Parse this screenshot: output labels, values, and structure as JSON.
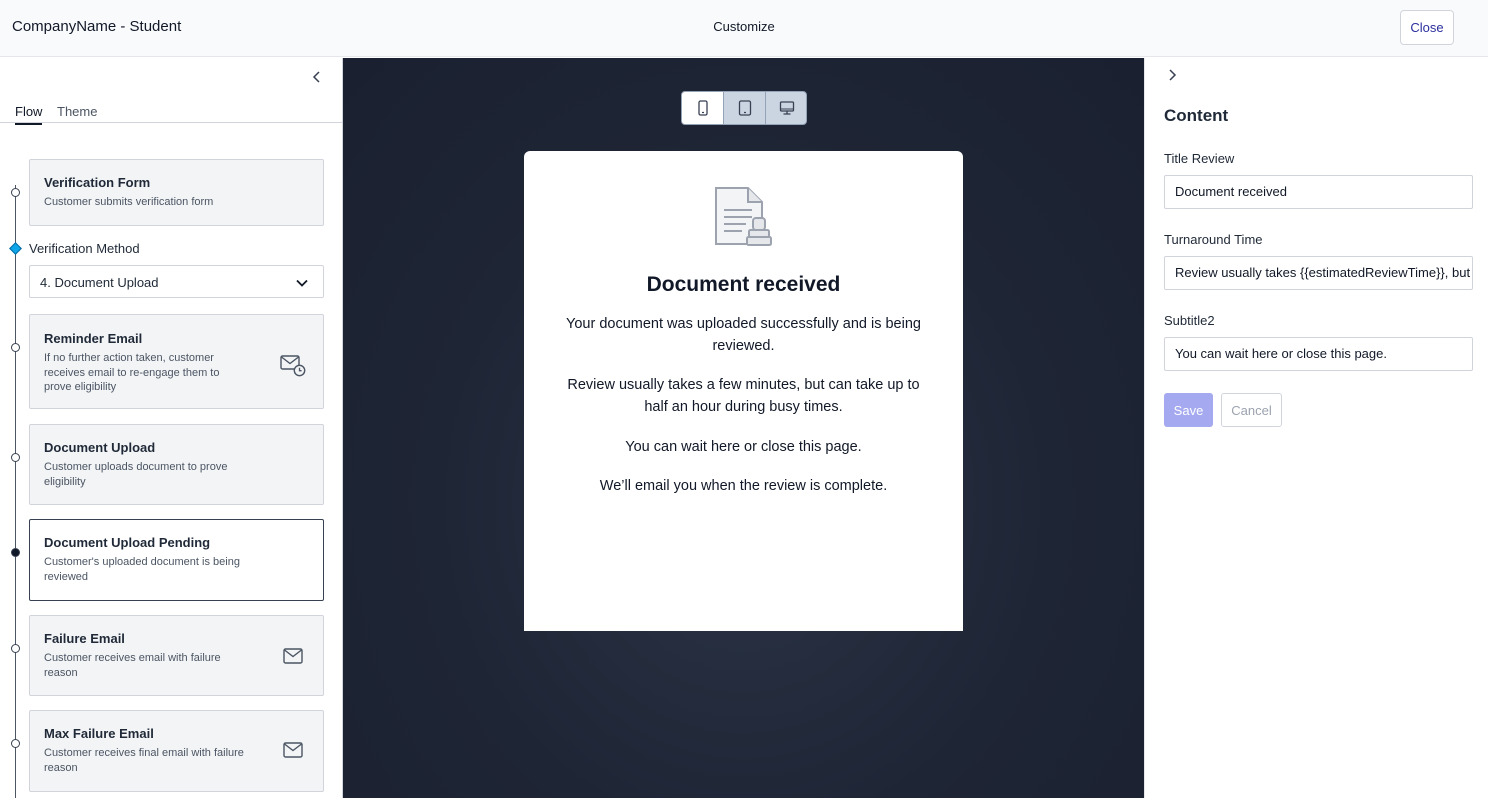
{
  "header": {
    "app_title": "CompanyName - Student",
    "center_title": "Customize",
    "close_label": "Close"
  },
  "left_panel": {
    "tabs": [
      {
        "label": "Flow",
        "active": true
      },
      {
        "label": "Theme",
        "active": false
      }
    ],
    "verification_method": {
      "label": "Verification Method",
      "selected": "4. Document Upload"
    },
    "steps": [
      {
        "title": "Verification Form",
        "description": "Customer submits verification form",
        "icon": null
      },
      {
        "title": "Reminder Email",
        "description": "If no further action taken, customer receives email to re-engage them to prove eligibility",
        "icon": "email-clock-icon"
      },
      {
        "title": "Document Upload",
        "description": "Customer uploads document to prove eligibility",
        "icon": null
      },
      {
        "title": "Document Upload Pending",
        "description": "Customer's uploaded document is being reviewed",
        "icon": null,
        "selected": true
      },
      {
        "title": "Failure Email",
        "description": "Customer receives email with failure reason",
        "icon": "email-icon"
      },
      {
        "title": "Max Failure Email",
        "description": "Customer receives final email with failure reason",
        "icon": "email-icon"
      }
    ]
  },
  "preview": {
    "device_modes": [
      "mobile-icon",
      "tablet-icon",
      "desktop-icon"
    ],
    "active_device": "mobile",
    "title": "Document received",
    "paragraphs": [
      "Your document was uploaded successfully and is being reviewed.",
      "Review usually takes a few minutes, but can take up to half an hour during busy times.",
      "You can wait here or close this page.",
      "We’ll email you when the review is complete."
    ]
  },
  "right_panel": {
    "title": "Content",
    "fields": [
      {
        "label": "Title Review",
        "value": "Document received"
      },
      {
        "label": "Turnaround Time",
        "value": "Review usually takes {{estimatedReviewTime}}, but can take up to half an hour during busy times."
      },
      {
        "label": "Subtitle2",
        "value": "You can wait here or close this page."
      }
    ],
    "save_label": "Save",
    "cancel_label": "Cancel"
  },
  "colors": {
    "accent": "#2b2f9e",
    "save_disabled": "#a5a9ef",
    "preview_bg": "#1e2535",
    "diamond": "#0ea5e9"
  }
}
